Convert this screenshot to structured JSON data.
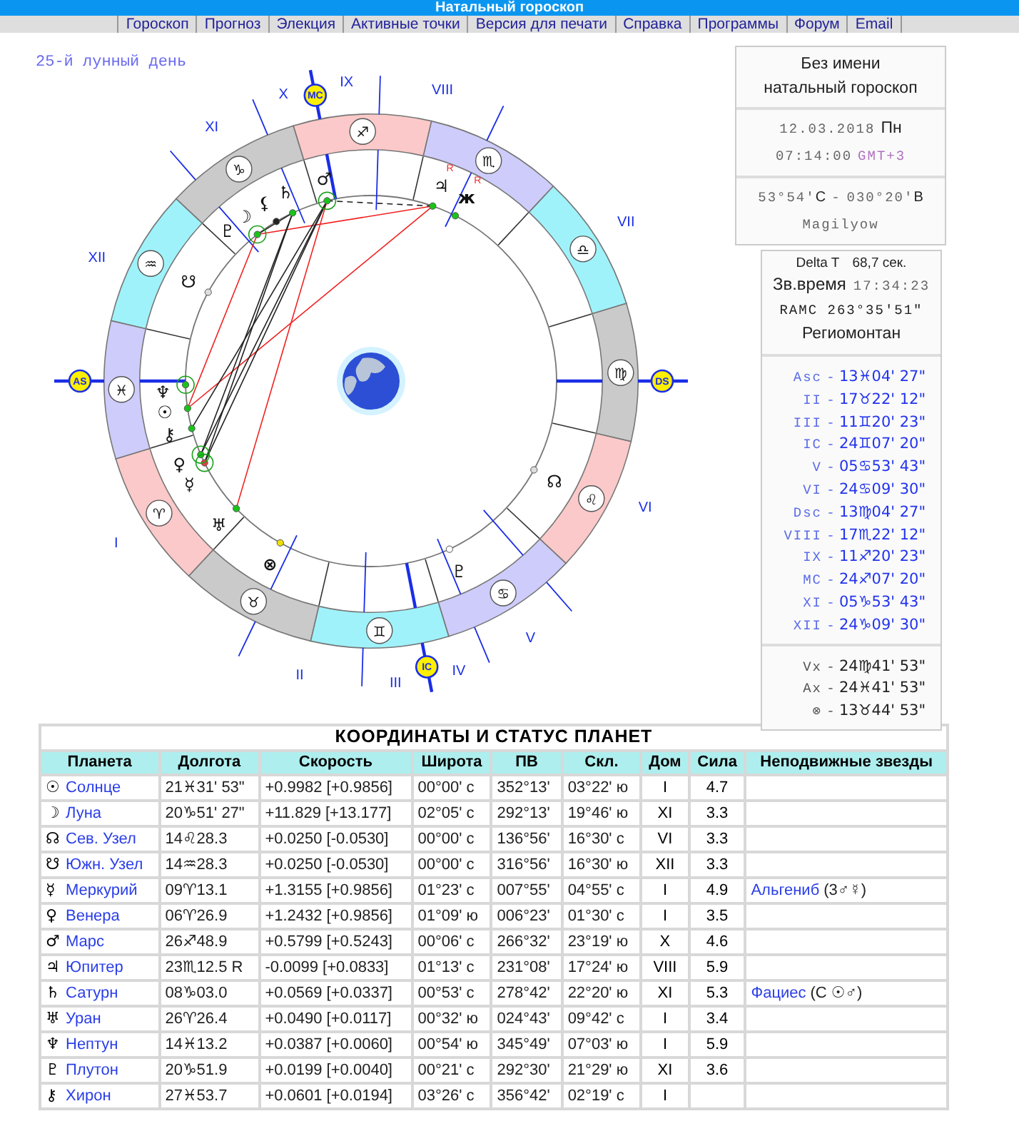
{
  "page_title": "Натальный гороскоп",
  "nav": [
    {
      "label": "Гороскоп"
    },
    {
      "label": "Прогноз"
    },
    {
      "label": "Элекция"
    },
    {
      "label": "Активные точки"
    },
    {
      "label": "Версия для печати"
    },
    {
      "label": "Справка"
    },
    {
      "label": "Программы"
    },
    {
      "label": "Форум"
    },
    {
      "label": "Email"
    }
  ],
  "wheel": {
    "lunar_day": "25-й лунный день",
    "signs": [
      {
        "glyph": "♈",
        "color": "#fbc9c9"
      },
      {
        "glyph": "♉",
        "color": "#cacaca"
      },
      {
        "glyph": "♊",
        "color": "#a0f2fa"
      },
      {
        "glyph": "♋",
        "color": "#cdccfa"
      },
      {
        "glyph": "♌",
        "color": "#fbc9c9"
      },
      {
        "glyph": "♍",
        "color": "#cacaca"
      },
      {
        "glyph": "♎",
        "color": "#a0f2fa"
      },
      {
        "glyph": "♏",
        "color": "#cdccfa"
      },
      {
        "glyph": "♐",
        "color": "#fbc9c9"
      },
      {
        "glyph": "♑",
        "color": "#cacaca"
      },
      {
        "glyph": "♒",
        "color": "#a0f2fa"
      },
      {
        "glyph": "♓",
        "color": "#cdccfa"
      }
    ],
    "houses": [
      {
        "numeral": "I"
      },
      {
        "numeral": "II"
      },
      {
        "numeral": "III"
      },
      {
        "numeral": "IV"
      },
      {
        "numeral": "V"
      },
      {
        "numeral": "VI"
      },
      {
        "numeral": "VII"
      },
      {
        "numeral": "VIII"
      },
      {
        "numeral": "IX"
      },
      {
        "numeral": "X"
      },
      {
        "numeral": "XI"
      },
      {
        "numeral": "XII"
      }
    ],
    "axes": [
      {
        "label": "AS"
      },
      {
        "label": "IC"
      },
      {
        "label": "DS"
      },
      {
        "label": "MC"
      }
    ],
    "points": [
      {
        "glyph": "♂"
      },
      {
        "glyph": "♄"
      },
      {
        "glyph": "⚸"
      },
      {
        "glyph": "☽"
      },
      {
        "glyph": "♇"
      },
      {
        "glyph": "☋"
      },
      {
        "glyph": "♆"
      },
      {
        "glyph": "☉"
      },
      {
        "glyph": "⚷"
      },
      {
        "glyph": "♀"
      },
      {
        "glyph": "☿"
      },
      {
        "glyph": "♅"
      },
      {
        "glyph": "⊗"
      },
      {
        "glyph": "♇"
      },
      {
        "glyph": "☊"
      },
      {
        "glyph": "♃",
        "mark": "R"
      },
      {
        "glyph": "ж",
        "mark": "R"
      }
    ]
  },
  "chart_info": {
    "title": "Без имени",
    "subtitle": "натальный гороскоп",
    "date": "12.03.2018",
    "weekday": "Пн",
    "time": "07:14:00",
    "timezone": "GMT+3",
    "latitude": "53°54'",
    "lat_dir": "С",
    "separator": "-",
    "longitude": "030°20'",
    "lon_dir": "В",
    "place": "Magilyow"
  },
  "sidereal": {
    "delta_t_label": "Delta T",
    "delta_t": "68,7 сек.",
    "sidereal_label": "Зв.время",
    "sidereal_time": "17:34:23",
    "ramc": "RAMC 263°35'51\"",
    "house_system": "Региомонтан"
  },
  "cusps": [
    {
      "label": "Asc",
      "dash": "-",
      "value": "13♓04' 27\""
    },
    {
      "label": "II",
      "dash": "-",
      "value": "17♉22' 12\""
    },
    {
      "label": "III",
      "dash": "-",
      "value": "11♊20' 23\""
    },
    {
      "label": "IC",
      "dash": "-",
      "value": "24♊07' 20\""
    },
    {
      "label": "V",
      "dash": "-",
      "value": "05♋53' 43\""
    },
    {
      "label": "VI",
      "dash": "-",
      "value": "24♋09' 30\""
    },
    {
      "label": "Dsc",
      "dash": "-",
      "value": "13♍04' 27\""
    },
    {
      "label": "VIII",
      "dash": "-",
      "value": "17♏22' 12\""
    },
    {
      "label": "IX",
      "dash": "-",
      "value": "11♐20' 23\""
    },
    {
      "label": "MC",
      "dash": "-",
      "value": "24♐07' 20\""
    },
    {
      "label": "XI",
      "dash": "-",
      "value": "05♑53' 43\""
    },
    {
      "label": "XII",
      "dash": "-",
      "value": "24♑09' 30\""
    }
  ],
  "extra_points": [
    {
      "label": "Vx",
      "dash": "-",
      "value": "24♍41' 53\""
    },
    {
      "label": "Ax",
      "dash": "-",
      "value": "24♓41' 53\""
    },
    {
      "label": "⊗",
      "dash": "-",
      "value": "13♉44' 53\""
    }
  ],
  "table": {
    "title": "КООРДИНАТЫ И СТАТУС ПЛАНЕТ",
    "columns": [
      "Планета",
      "Долгота",
      "Скорость",
      "Широта",
      "ПВ",
      "Скл.",
      "Дом",
      "Сила",
      "Неподвижные звезды"
    ],
    "rows": [
      {
        "glyph": "☉",
        "name": "Солнце",
        "longitude": "21♓31' 53\"",
        "speed": "+0.9982  [+0.9856]",
        "latitude": "00°00' с",
        "ra": "352°13'",
        "declination": "03°22' ю",
        "house": "I",
        "strength": "4.7"
      },
      {
        "glyph": "☽",
        "name": "Луна",
        "longitude": "20♑51' 27\"",
        "speed": "+11.829  [+13.177]",
        "latitude": "02°05' с",
        "ra": "292°13'",
        "declination": "19°46' ю",
        "house": "XI",
        "strength": "3.3"
      },
      {
        "glyph": "☊",
        "name": "Сев. Узел",
        "longitude": "14♌28.3",
        "speed": "+0.0250  [-0.0530]",
        "latitude": "00°00' с",
        "ra": "136°56'",
        "declination": "16°30' с",
        "house": "VI",
        "strength": "3.3"
      },
      {
        "glyph": "☋",
        "name": "Южн. Узел",
        "longitude": "14♒28.3",
        "speed": "+0.0250  [-0.0530]",
        "latitude": "00°00' с",
        "ra": "316°56'",
        "declination": "16°30' ю",
        "house": "XII",
        "strength": "3.3"
      },
      {
        "glyph": "☿",
        "name": "Меркурий",
        "longitude": "09♈13.1",
        "speed": "+1.3155  [+0.9856]",
        "latitude": "01°23' с",
        "ra": "007°55'",
        "declination": "04°55' с",
        "house": "I",
        "strength": "4.9",
        "star": "Альгениб",
        "star_note": "(3♂☿)"
      },
      {
        "glyph": "♀",
        "name": "Венера",
        "longitude": "06♈26.9",
        "speed": "+1.2432  [+0.9856]",
        "latitude": "01°09' ю",
        "ra": "006°23'",
        "declination": "01°30' с",
        "house": "I",
        "strength": "3.5"
      },
      {
        "glyph": "♂",
        "name": "Марс",
        "longitude": "26♐48.9",
        "speed": "+0.5799  [+0.5243]",
        "latitude": "00°06' с",
        "ra": "266°32'",
        "declination": "23°19' ю",
        "house": "X",
        "strength": "4.6"
      },
      {
        "glyph": "♃",
        "name": "Юпитер",
        "longitude": "23♏12.5  R",
        "speed": "-0.0099  [+0.0833]",
        "latitude": "01°13' с",
        "ra": "231°08'",
        "declination": "17°24' ю",
        "house": "VIII",
        "strength": "5.9"
      },
      {
        "glyph": "♄",
        "name": "Сатурн",
        "longitude": "08♑03.0",
        "speed": "+0.0569  [+0.0337]",
        "latitude": "00°53' с",
        "ra": "278°42'",
        "declination": "22°20' ю",
        "house": "XI",
        "strength": "5.3",
        "star": "Фациес",
        "star_note": "(С ☉♂)"
      },
      {
        "glyph": "♅",
        "name": "Уран",
        "longitude": "26♈26.4",
        "speed": "+0.0490  [+0.0117]",
        "latitude": "00°32' ю",
        "ra": "024°43'",
        "declination": "09°42' с",
        "house": "I",
        "strength": "3.4"
      },
      {
        "glyph": "♆",
        "name": "Нептун",
        "longitude": "14♓13.2",
        "speed": "+0.0387  [+0.0060]",
        "latitude": "00°54' ю",
        "ra": "345°49'",
        "declination": "07°03' ю",
        "house": "I",
        "strength": "5.9"
      },
      {
        "glyph": "♇",
        "name": "Плутон",
        "longitude": "20♑51.9",
        "speed": "+0.0199  [+0.0040]",
        "latitude": "00°21' с",
        "ra": "292°30'",
        "declination": "21°29' ю",
        "house": "XI",
        "strength": "3.6"
      },
      {
        "glyph": "⚷",
        "name": "Хирон",
        "longitude": "27♓53.7",
        "speed": "+0.0601  [+0.0194]",
        "latitude": "03°26' с",
        "ra": "356°42'",
        "declination": "02°19' с",
        "house": "I"
      }
    ]
  }
}
